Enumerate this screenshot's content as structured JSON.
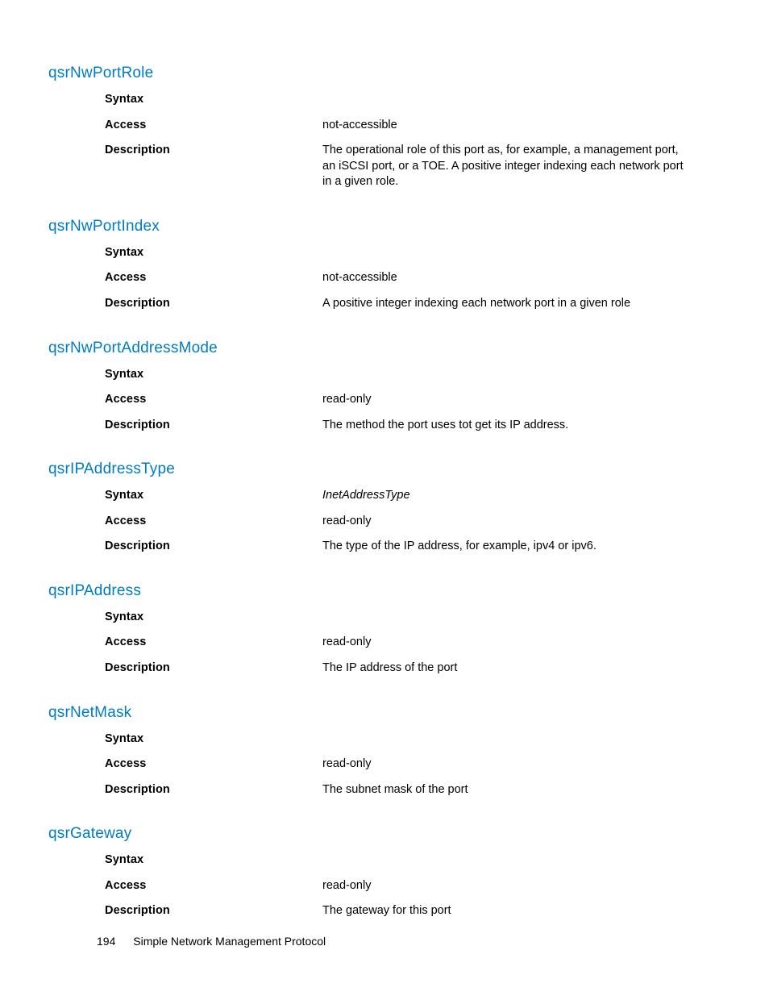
{
  "labels": {
    "syntax": "Syntax",
    "access": "Access",
    "description": "Description"
  },
  "sections": [
    {
      "title": "qsrNwPortRole",
      "syntax": "",
      "access": "not-accessible",
      "description": "The operational role of this port as, for example, a management port, an iSCSI port, or a TOE. A positive integer indexing each network port in a given role."
    },
    {
      "title": "qsrNwPortIndex",
      "syntax": "",
      "access": "not-accessible",
      "description": "A positive integer indexing each network port in a given role"
    },
    {
      "title": "qsrNwPortAddressMode",
      "syntax": "",
      "access": "read-only",
      "description": "The method the port uses tot get its IP address."
    },
    {
      "title": "qsrIPAddressType",
      "syntax": "InetAddressType",
      "syntax_italic": true,
      "access": "read-only",
      "description": "The type of the IP address, for example, ipv4 or ipv6."
    },
    {
      "title": "qsrIPAddress",
      "syntax": "",
      "access": "read-only",
      "description": "The IP address of the port"
    },
    {
      "title": "qsrNetMask",
      "syntax": "",
      "access": "read-only",
      "description": "The subnet mask of the port"
    },
    {
      "title": "qsrGateway",
      "syntax": "",
      "access": "read-only",
      "description": "The gateway for this port"
    }
  ],
  "footer": {
    "page_number": "194",
    "title": "Simple Network Management Protocol"
  }
}
